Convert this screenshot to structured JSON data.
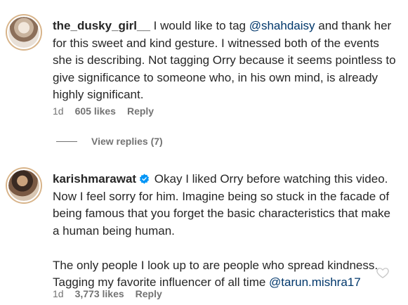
{
  "comments": [
    {
      "username": "the_dusky_girl__",
      "text_pre": " I would like to tag ",
      "mention": "@shahdaisy",
      "text_post": " and thank her for this sweet and kind gesture. I witnessed both of the events she is describing. Not tagging Orry because it seems pointless to give significance to someone who, in his own mind, is already highly significant.",
      "age": "1d",
      "likes": "605 likes",
      "reply": "Reply",
      "view_replies": "View replies (7)"
    },
    {
      "username": "karishmarawat",
      "verified": true,
      "text_pre": " Okay I liked Orry before watching this video. Now I feel sorry for him. Imagine being so stuck in the facade of being famous that you forget the basic characteristics that make a human being human.",
      "text_para2": "The only people I look up to are people who spread kindness. Tagging my favorite influencer of all time ",
      "mention": "@tarun.mishra17",
      "age": "1d",
      "likes": "3,773 likes",
      "reply": "Reply"
    }
  ],
  "icons": {
    "verified_color": "#0095f6",
    "like": "heart-outline-icon"
  }
}
